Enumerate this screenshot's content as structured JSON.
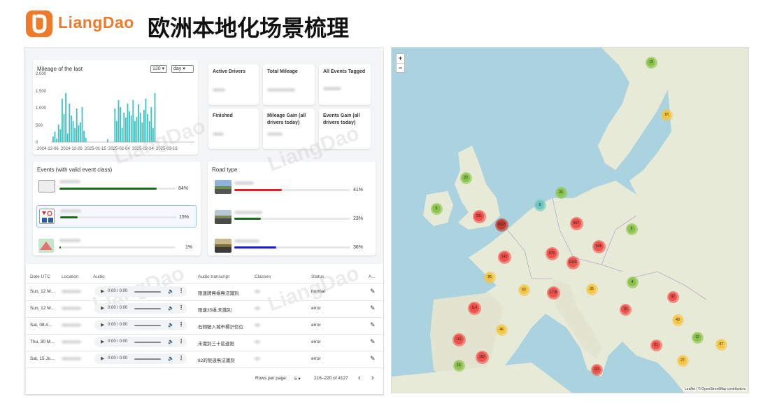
{
  "header": {
    "logo_text": "LiangDao",
    "title": "欧洲本地化场景梳理"
  },
  "mileage": {
    "label": "Mileage of the last",
    "select_value": "120",
    "unit_value": "day",
    "yticks": [
      "2,000",
      "1,500",
      "1,000",
      "500",
      "0"
    ],
    "xticks": [
      "2024-12-06",
      "2024-12-26",
      "2025-01-15",
      "2025-02-04",
      "2025-02-24",
      "2025-03-16"
    ]
  },
  "stats": {
    "active_drivers": "Active Drivers",
    "total_mileage": "Total Mileage",
    "all_events_tagged": "All Events Tagged",
    "finished": "Finished",
    "mileage_gain": "Mileage Gain (all drivers today)",
    "events_gain": "Events Gain (all drivers today)"
  },
  "events": {
    "title": "Events (with valid event class)",
    "items": [
      {
        "pct": "84%",
        "color": "#1b6a1b",
        "fraction": 0.84
      },
      {
        "pct": "15%",
        "color": "#1b6a1b",
        "fraction": 0.15
      },
      {
        "pct": "1%",
        "color": "#1b6a1b",
        "fraction": 0.01
      }
    ]
  },
  "road": {
    "title": "Road type",
    "items": [
      {
        "pct": "41%",
        "color": "#e02424",
        "fraction": 0.41
      },
      {
        "pct": "23%",
        "color": "#1b6a1b",
        "fraction": 0.23
      },
      {
        "pct": "36%",
        "color": "#1a1adb",
        "fraction": 0.36
      }
    ]
  },
  "table": {
    "headers": [
      "Date UTC",
      "Location",
      "Audio",
      "Audio transcript",
      "Classes",
      "Status",
      "A..."
    ],
    "audio_time": "0:00 / 0:00",
    "rows": [
      {
        "date": "Sun, 12 M...",
        "transcript": "限速牌無損無法識別",
        "status": "normal"
      },
      {
        "date": "Sun, 12 M...",
        "transcript": "限速35損,未識別",
        "status": "error"
      },
      {
        "date": "Sat, 08 A...",
        "transcript": "右側駛入城市標识信位",
        "status": "error"
      },
      {
        "date": "Thu, 30 M...",
        "transcript": "未識別三十區速限",
        "status": "error"
      },
      {
        "date": "Sat, 15 Ju...",
        "transcript": "82的限速無法識別",
        "status": "error"
      }
    ],
    "pager": {
      "rows_per_page_label": "Rows per page:",
      "rows_per_page": "5",
      "range": "216–220 of 4127",
      "prev": "‹",
      "next": "›"
    }
  },
  "map": {
    "zoom_in": "+",
    "zoom_out": "−",
    "attribution": "Leaflet | © OpenStreetMap contributors",
    "clusters": [
      {
        "label": "12",
        "color": "#8bc34a"
      },
      {
        "label": "18",
        "color": "#f5c542"
      },
      {
        "label": "22",
        "color": "#8bc34a"
      },
      {
        "label": "5",
        "color": "#8bc34a"
      },
      {
        "label": "26",
        "color": "#8bc34a"
      },
      {
        "label": "5",
        "color": "#6cc6c0"
      },
      {
        "label": "231",
        "color": "#f0504a"
      },
      {
        "label": "2017",
        "color": "#c0392b"
      },
      {
        "label": "567",
        "color": "#f0504a"
      },
      {
        "label": "9",
        "color": "#8bc34a"
      },
      {
        "label": "876",
        "color": "#f0504a"
      },
      {
        "label": "508",
        "color": "#f0504a"
      },
      {
        "label": "142",
        "color": "#f0504a"
      },
      {
        "label": "1040",
        "color": "#f0504a"
      },
      {
        "label": "26",
        "color": "#f5c542"
      },
      {
        "label": "63",
        "color": "#f5c542"
      },
      {
        "label": "1778",
        "color": "#f0504a"
      },
      {
        "label": "35",
        "color": "#f5c542"
      },
      {
        "label": "4",
        "color": "#8bc34a"
      },
      {
        "label": "114",
        "color": "#f0504a"
      },
      {
        "label": "19",
        "color": "#f0504a"
      },
      {
        "label": "92",
        "color": "#f0504a"
      },
      {
        "label": "43",
        "color": "#f5c542"
      },
      {
        "label": "46",
        "color": "#f5c542"
      },
      {
        "label": "161",
        "color": "#f0504a"
      },
      {
        "label": "12",
        "color": "#8bc34a"
      },
      {
        "label": "15",
        "color": "#8bc34a"
      },
      {
        "label": "150",
        "color": "#f0504a"
      },
      {
        "label": "61",
        "color": "#f0504a"
      },
      {
        "label": "47",
        "color": "#f5c542"
      },
      {
        "label": "27",
        "color": "#f5c542"
      },
      {
        "label": "60",
        "color": "#f0504a"
      }
    ]
  }
}
